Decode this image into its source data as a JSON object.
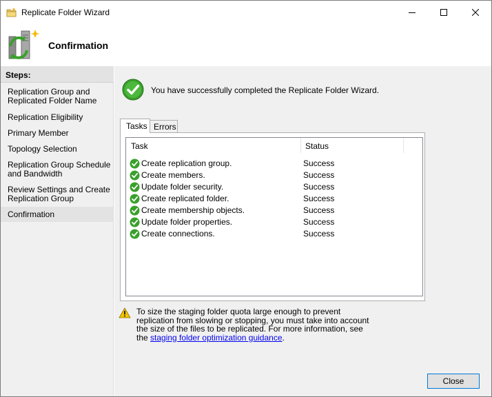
{
  "window": {
    "title": "Replicate Folder Wizard",
    "icons": {
      "app": "folder-wizard-icon",
      "minimize": "minimize-icon",
      "maximize": "maximize-icon",
      "close": "close-icon"
    }
  },
  "header": {
    "title": "Confirmation",
    "icon": "replication-server-icon"
  },
  "sidebar": {
    "heading": "Steps:",
    "items": [
      {
        "label": "Replication Group and Replicated Folder Name"
      },
      {
        "label": "Replication Eligibility"
      },
      {
        "label": "Primary Member"
      },
      {
        "label": "Topology Selection"
      },
      {
        "label": "Replication Group Schedule and Bandwidth"
      },
      {
        "label": "Review Settings and Create Replication Group"
      },
      {
        "label": "Confirmation",
        "active": true
      }
    ]
  },
  "main": {
    "success_message": "You have successfully completed the Replicate Folder Wizard.",
    "tabs": [
      {
        "label": "Tasks",
        "selected": true
      },
      {
        "label": "Errors"
      }
    ],
    "columns": [
      "Task",
      "Status"
    ],
    "rows": [
      {
        "task": "Create replication group.",
        "status": "Success"
      },
      {
        "task": "Create members.",
        "status": "Success"
      },
      {
        "task": "Update folder security.",
        "status": "Success"
      },
      {
        "task": "Create replicated folder.",
        "status": "Success"
      },
      {
        "task": "Create membership objects.",
        "status": "Success"
      },
      {
        "task": "Update folder properties.",
        "status": "Success"
      },
      {
        "task": "Create connections.",
        "status": "Success"
      }
    ],
    "warning": {
      "text": "To size the staging folder quota large enough to prevent replication from slowing or stopping, you must take into account the size of the files to be replicated. For more information, see the",
      "link": "staging folder optimization guidance",
      "end": "."
    },
    "close_button": "Close"
  },
  "colors": {
    "accent": "#0078d7",
    "success": "#3aa02c",
    "warning": "#f5c400",
    "link": "#0000ee"
  }
}
